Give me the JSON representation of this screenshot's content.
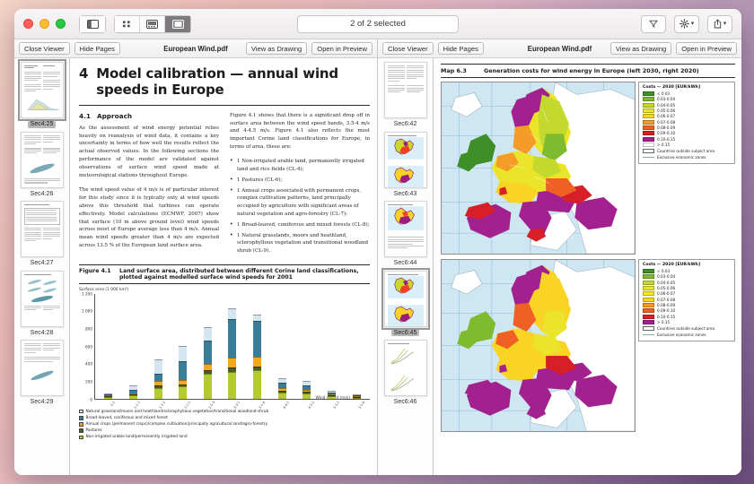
{
  "window": {
    "title": "",
    "traffic_lights": [
      "close",
      "minimize",
      "zoom"
    ],
    "search_value": "2 of 2 selected",
    "view_modes": [
      "sidebar-toggle",
      "icon-grid-view",
      "gallery-view",
      "split-view"
    ],
    "right_buttons": [
      "filter-icon",
      "gear-icon",
      "share-icon"
    ]
  },
  "panes": [
    {
      "id": "left",
      "close_label": "Close Viewer",
      "hide_label": "Hide Pages",
      "title": "European Wind.pdf",
      "view_drawing_label": "View as Drawing",
      "open_preview_label": "Open in Preview",
      "thumbnails": [
        {
          "label": "Sec4:25",
          "selected": true,
          "kind": "text-chart"
        },
        {
          "label": "Sec4:26",
          "selected": false,
          "kind": "text-scatter"
        },
        {
          "label": "Sec4:27",
          "selected": false,
          "kind": "table"
        },
        {
          "label": "Sec4:28",
          "selected": false,
          "kind": "multi-scatter"
        },
        {
          "label": "Sec4:29",
          "selected": false,
          "kind": "text-scatter"
        }
      ]
    },
    {
      "id": "right",
      "close_label": "Close Viewer",
      "hide_label": "Hide Pages",
      "title": "European Wind.pdf",
      "view_drawing_label": "View as Drawing",
      "open_preview_label": "Open in Preview",
      "thumbnails": [
        {
          "label": "Sec6:42",
          "selected": false,
          "kind": "text-two-col"
        },
        {
          "label": "Sec6:43",
          "selected": false,
          "kind": "two-maps"
        },
        {
          "label": "Sec6:44",
          "selected": false,
          "kind": "one-map"
        },
        {
          "label": "Sec6:45",
          "selected": true,
          "kind": "two-maps"
        },
        {
          "label": "Sec6:46",
          "selected": false,
          "kind": "curves"
        }
      ]
    }
  ],
  "document_left": {
    "chapter_number": "4",
    "title": "Model calibration — annual wind speeds in Europe",
    "section_number": "4.1",
    "section_title": "Approach",
    "paragraphs_left": [
      "As the assessment of wind energy potential relies heavily on reanalysis of wind data, it contains a key uncertainty in terms of how well the results reflect the actual observed values. In the following sections the performance of the model are validated against observations of surface wind speed made at meteorological stations throughout Europe.",
      "The wind speed value of 4 m/s is of particular interest for this study since it is typically only at wind speeds above this threshold that turbines can operate effectively. Model calculations (ECMWF, 2007) show that surface (10 m above ground level) wind speeds across most of Europe average less than 4 m/s. Annual mean wind speeds greater than 4 m/s are expected across 13.5 % of the European land surface area."
    ],
    "paragraphs_right": [
      "Figure 4.1 shows that there is a significant drop off in surface area between the wind speed bands, 3.5-4 m/s and 4-4.5 m/s. Figure 4.1 also reflects the most important Corine land classifications for Europe, in terms of area, these are:"
    ],
    "bullets": [
      "1 Non-irrigated arable land, permanently irrigated land and rice fields (CL-4);",
      "1 Pastures (CL-6);",
      "1 Annual crops associated with permanent crops, complex cultivation patterns, land principally occupied by agriculture with significant areas of natural vegetation and agro-forestry (CL-7);",
      "1 Broad-leaved, coniferous and mixed forests (CL-8);",
      "1 Natural grasslands, moors and heathland, sclerophyllous vegetation and transitional woodland shrub (CL-9)."
    ],
    "figure_label": "Figure 4.1",
    "figure_caption": "Land surface area, distributed between different Corine land classifications, plotted against modelled surface wind speeds for 2001"
  },
  "chart_data": {
    "type": "bar",
    "stacked": true,
    "title": "Land surface area, distributed between different Corine land classifications, plotted against modelled surface wind speeds for 2001",
    "ylabel": "Surface area (1 000 km²)",
    "xlabel": "Wind speed (m/s)",
    "ylim": [
      0,
      1200
    ],
    "yticks": [
      0,
      200,
      400,
      600,
      800,
      "1 000",
      "1 200"
    ],
    "categories": [
      "0-1",
      "1-1.5",
      "1.5-2",
      "2-2.5",
      "2.5-3",
      "3-3.5",
      "3.5-4",
      "4-4.5",
      "4.5-5",
      "5-5.5",
      "5.5-6"
    ],
    "series": [
      {
        "name": "Non-irrigated arable land/permanently irrigated land",
        "color": "#b5c930",
        "values": [
          12,
          35,
          120,
          135,
          280,
          305,
          320,
          70,
          58,
          28,
          10
        ]
      },
      {
        "name": "Pastures",
        "color": "#4b5d22",
        "values": [
          3,
          12,
          30,
          28,
          42,
          45,
          42,
          22,
          18,
          10,
          3
        ]
      },
      {
        "name": "Annual crops (permanent crops)/complex cultivation/principally agricultural land/agro-forestry",
        "color": "#f5a623",
        "values": [
          3,
          14,
          50,
          50,
          70,
          115,
          110,
          28,
          25,
          12,
          4
        ]
      },
      {
        "name": "Broad-leaved, coniferous and mixed forest",
        "color": "#3a7d99",
        "values": [
          6,
          40,
          80,
          215,
          270,
          440,
          410,
          60,
          50,
          22,
          7
        ]
      },
      {
        "name": "Natural grassland/moors and heathland/sclerophyllous vegetation/transitional woodland-shrub",
        "color": "#d4e6f0",
        "values": [
          4,
          50,
          160,
          165,
          145,
          115,
          75,
          50,
          45,
          15,
          5
        ]
      }
    ],
    "legend": [
      {
        "label": "Natural grassland/moors and heathland/sclerophyllous vegetation/transitional woodland-shrub",
        "color": "#d4e6f0"
      },
      {
        "label": "Broad-leaved, coniferous and mixed forest",
        "color": "#3a7d99"
      },
      {
        "label": "Annual crops (permanent crops)/complex cultivation/principally agricultural land/agro-forestry",
        "color": "#f5a623"
      },
      {
        "label": "Pastures",
        "color": "#4b5d22"
      },
      {
        "label": "Non-irrigated arable land/permanently irrigated land",
        "color": "#b5c930"
      }
    ],
    "legend_position": "below"
  },
  "document_right": {
    "map_label": "Map 6.3",
    "map_caption": "Generation costs for wind energy in Europe (left 2030, right 2020)",
    "legends": [
      {
        "title": "Costs — 2030 [EUR/kWh]",
        "bands": [
          {
            "label": "< 0.03",
            "color": "#3f8f29"
          },
          {
            "label": "0.03-0.04",
            "color": "#7fbb2e"
          },
          {
            "label": "0.04-0.05",
            "color": "#c4d92e"
          },
          {
            "label": "0.05-0.06",
            "color": "#eae52b"
          },
          {
            "label": "0.06-0.07",
            "color": "#f9d424"
          },
          {
            "label": "0.07-0.08",
            "color": "#f59b28"
          },
          {
            "label": "0.08-0.09",
            "color": "#ef6024"
          },
          {
            "label": "0.09-0.10",
            "color": "#d61f26"
          },
          {
            "label": "0.10-0.15",
            "color": "#a3218f"
          },
          {
            "label": "> 0.15",
            "color": "#ffffff"
          }
        ],
        "extra": [
          {
            "label": "Countries outside subject area",
            "kind": "outline"
          },
          {
            "label": "Exclusive economic zones",
            "kind": "line"
          }
        ]
      },
      {
        "title": "Costs — 2020 [EUR/kWh]",
        "bands": [
          {
            "label": "< 0.03",
            "color": "#3f8f29"
          },
          {
            "label": "0.03-0.04",
            "color": "#7fbb2e"
          },
          {
            "label": "0.04-0.05",
            "color": "#c4d92e"
          },
          {
            "label": "0.05-0.06",
            "color": "#eae52b"
          },
          {
            "label": "0.06-0.07",
            "color": "#f9e52b"
          },
          {
            "label": "0.07-0.08",
            "color": "#f9d424"
          },
          {
            "label": "0.08-0.09",
            "color": "#f59b28"
          },
          {
            "label": "0.09-0.10",
            "color": "#ef6024"
          },
          {
            "label": "0.10-0.15",
            "color": "#d61f26"
          },
          {
            "label": "> 0.15",
            "color": "#a3218f"
          }
        ],
        "extra": [
          {
            "label": "Countries outside subject area",
            "kind": "outline"
          },
          {
            "label": "Exclusive economic zones",
            "kind": "line"
          }
        ]
      }
    ]
  }
}
